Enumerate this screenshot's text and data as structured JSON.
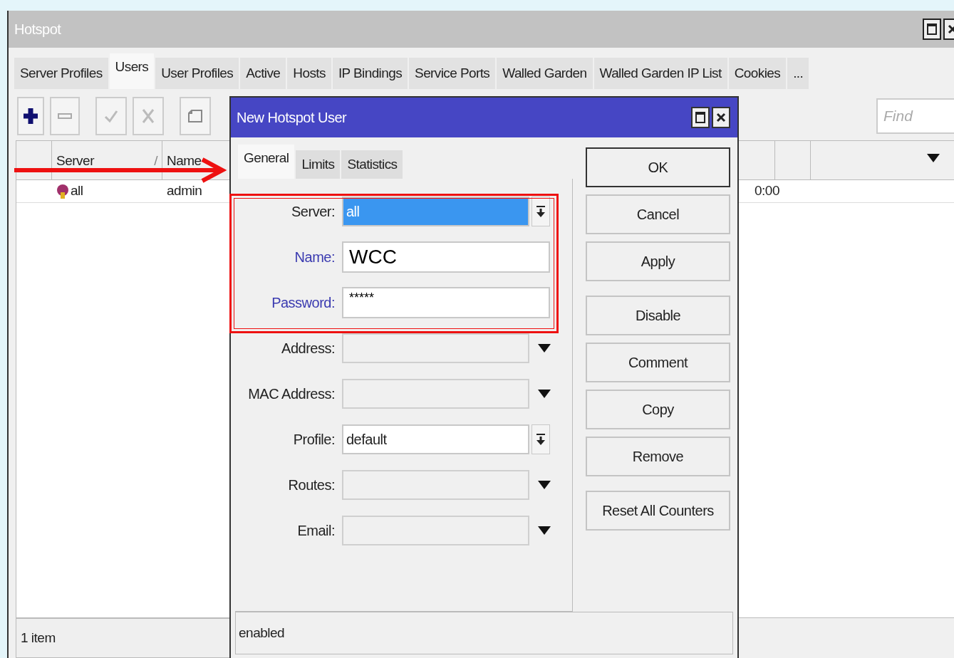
{
  "window": {
    "title": "Hotspot"
  },
  "tabs": [
    {
      "label": "Server Profiles",
      "selected": false
    },
    {
      "label": "Users",
      "selected": true
    },
    {
      "label": "User Profiles",
      "selected": false
    },
    {
      "label": "Active",
      "selected": false
    },
    {
      "label": "Hosts",
      "selected": false
    },
    {
      "label": "IP Bindings",
      "selected": false
    },
    {
      "label": "Service Ports",
      "selected": false
    },
    {
      "label": "Walled Garden",
      "selected": false
    },
    {
      "label": "Walled Garden IP List",
      "selected": false
    },
    {
      "label": "Cookies",
      "selected": false
    },
    {
      "label": "...",
      "selected": false
    }
  ],
  "toolbar": {
    "find_placeholder": "Find"
  },
  "table": {
    "columns": [
      {
        "label": "Server",
        "sort": "/"
      },
      {
        "label": "Name"
      }
    ],
    "rows": [
      {
        "server": "all",
        "name": "admin",
        "column_3": "0:00"
      }
    ]
  },
  "status_bar": "1 item",
  "dialog": {
    "title": "New Hotspot User",
    "tabs": [
      {
        "label": "General",
        "selected": true
      },
      {
        "label": "Limits",
        "selected": false
      },
      {
        "label": "Statistics",
        "selected": false
      }
    ],
    "fields": [
      {
        "label": "Server:",
        "kind": "select",
        "value": "all",
        "value_selected": true,
        "required": false,
        "highlighted": true
      },
      {
        "label": "Name:",
        "kind": "text",
        "value": "WCC",
        "required": true,
        "highlighted": true
      },
      {
        "label": "Password:",
        "kind": "text",
        "value": "*****",
        "required": true,
        "highlighted": true
      },
      {
        "label": "Address:",
        "kind": "combo",
        "required": false,
        "highlighted": false
      },
      {
        "label": "MAC Address:",
        "kind": "combo",
        "required": false,
        "highlighted": false
      },
      {
        "label": "Profile:",
        "kind": "select",
        "value": "default",
        "value_selected": false,
        "required": false,
        "highlighted": false
      },
      {
        "label": "Routes:",
        "kind": "combo",
        "required": false,
        "highlighted": false
      },
      {
        "label": "Email:",
        "kind": "combo",
        "required": false,
        "highlighted": false
      }
    ],
    "button_groups": [
      {
        "buttons": [
          {
            "label": "OK",
            "default": true
          },
          {
            "label": "Cancel",
            "default": false
          },
          {
            "label": "Apply",
            "default": false
          }
        ]
      },
      {
        "buttons": [
          {
            "label": "Disable",
            "default": false
          },
          {
            "label": "Comment",
            "default": false
          },
          {
            "label": "Copy",
            "default": false
          },
          {
            "label": "Remove",
            "default": false
          }
        ]
      },
      {
        "buttons": [
          {
            "label": "Reset All Counters",
            "default": false
          }
        ]
      }
    ],
    "status": "enabled"
  }
}
